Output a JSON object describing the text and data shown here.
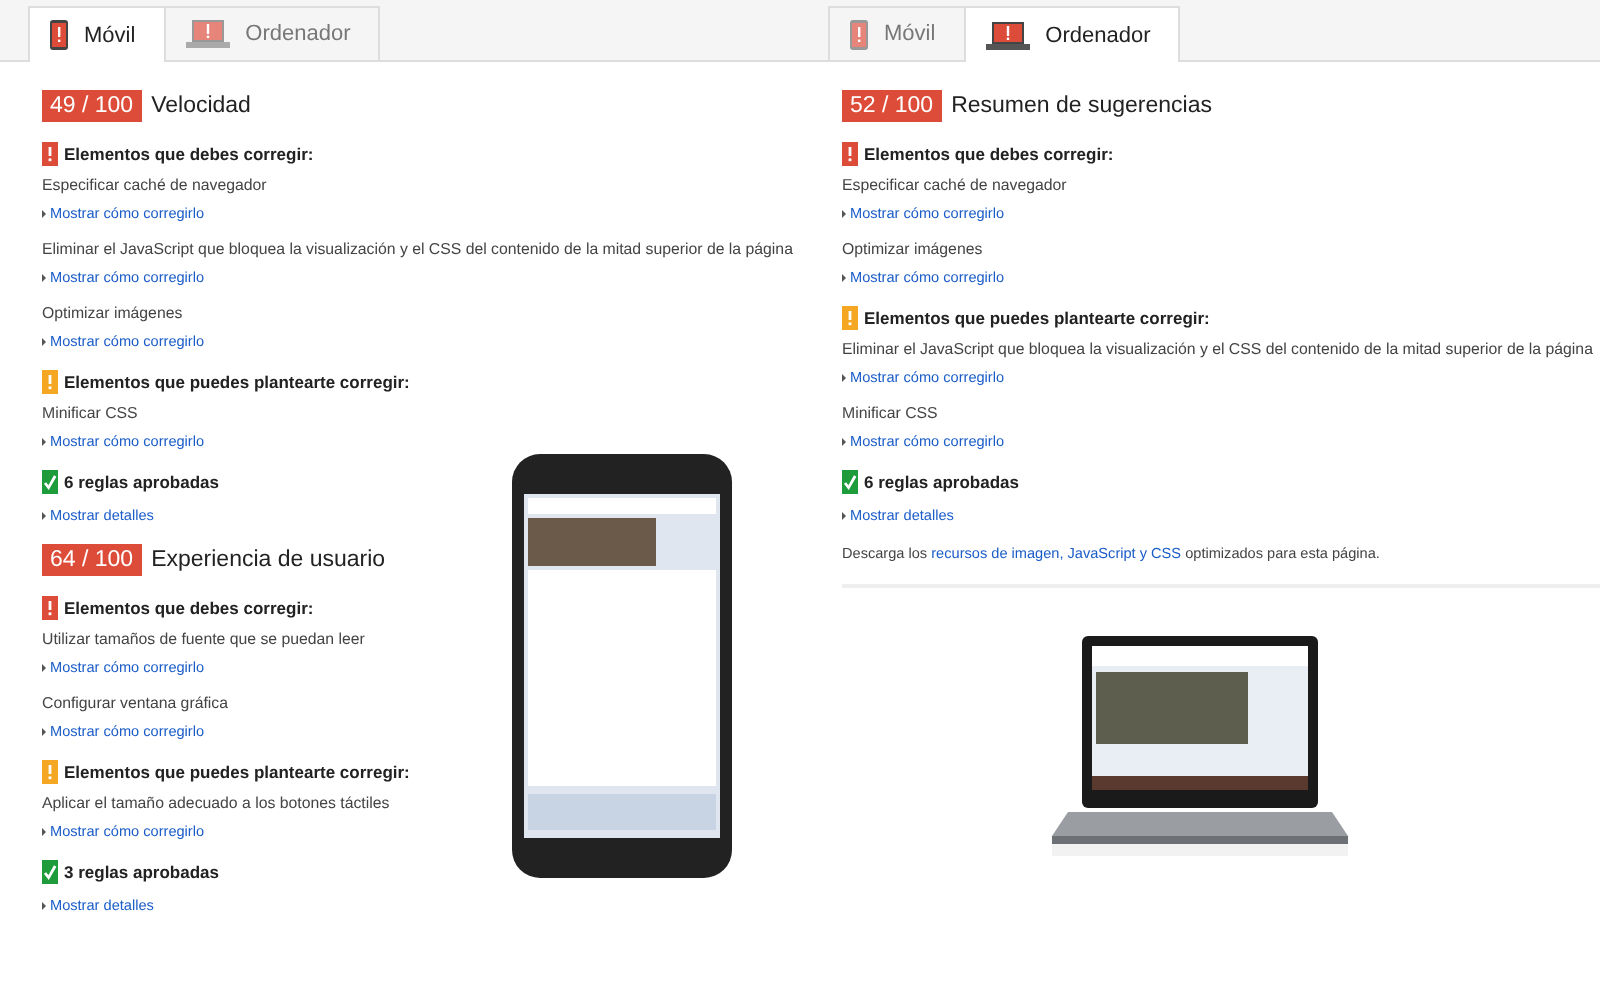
{
  "panels": [
    {
      "tabs": [
        {
          "label": "Móvil",
          "kind": "phone",
          "selected": true
        },
        {
          "label": "Ordenador",
          "kind": "laptop",
          "selected": false
        }
      ],
      "kind": "phone",
      "sections": [
        {
          "score": "49 / 100",
          "title": "Velocidad",
          "groups": [
            {
              "kind": "error",
              "heading": "Elementos que debes corregir:",
              "items": [
                {
                  "text": "Especificar caché de navegador",
                  "link": "Mostrar cómo corregirlo"
                },
                {
                  "text": "Eliminar el JavaScript que bloquea la visualización y el CSS del contenido de la mitad superior de la página",
                  "link": "Mostrar cómo corregirlo"
                },
                {
                  "text": "Optimizar imágenes",
                  "link": "Mostrar cómo corregirlo"
                }
              ]
            },
            {
              "kind": "warning",
              "heading": "Elementos que puedes plantearte corregir:",
              "items": [
                {
                  "text": "Minificar CSS",
                  "link": "Mostrar cómo corregirlo"
                }
              ]
            },
            {
              "kind": "pass",
              "heading": "6 reglas aprobadas",
              "items": [
                {
                  "link": "Mostrar detalles"
                }
              ]
            }
          ]
        },
        {
          "score": "64 / 100",
          "title": "Experiencia de usuario",
          "groups": [
            {
              "kind": "error",
              "heading": "Elementos que debes corregir:",
              "items": [
                {
                  "text": "Utilizar tamaños de fuente que se puedan leer",
                  "link": "Mostrar cómo corregirlo"
                },
                {
                  "text": "Configurar ventana gráfica",
                  "link": "Mostrar cómo corregirlo"
                }
              ]
            },
            {
              "kind": "warning",
              "heading": "Elementos que puedes plantearte corregir:",
              "items": [
                {
                  "text": "Aplicar el tamaño adecuado a los botones táctiles",
                  "link": "Mostrar cómo corregirlo"
                }
              ]
            },
            {
              "kind": "pass",
              "heading": "3 reglas aprobadas",
              "items": [
                {
                  "link": "Mostrar detalles"
                }
              ]
            }
          ]
        }
      ]
    },
    {
      "tabs": [
        {
          "label": "Móvil",
          "kind": "phone",
          "selected": false
        },
        {
          "label": "Ordenador",
          "kind": "laptop",
          "selected": true
        }
      ],
      "kind": "laptop",
      "sections": [
        {
          "score": "52 / 100",
          "title": "Resumen de sugerencias",
          "groups": [
            {
              "kind": "error",
              "heading": "Elementos que debes corregir:",
              "items": [
                {
                  "text": "Especificar caché de navegador",
                  "link": "Mostrar cómo corregirlo"
                },
                {
                  "text": "Optimizar imágenes",
                  "link": "Mostrar cómo corregirlo"
                }
              ]
            },
            {
              "kind": "warning",
              "heading": "Elementos que puedes plantearte corregir:",
              "items": [
                {
                  "text": "Eliminar el JavaScript que bloquea la visualización y el CSS del contenido de la mitad superior de la página",
                  "link": "Mostrar cómo corregirlo"
                },
                {
                  "text": "Minificar CSS",
                  "link": "Mostrar cómo corregirlo"
                }
              ]
            },
            {
              "kind": "pass",
              "heading": "6 reglas aprobadas",
              "items": [
                {
                  "link": "Mostrar detalles"
                }
              ]
            }
          ]
        }
      ],
      "download": {
        "before": "Descarga los",
        "link": "recursos de imagen, JavaScript y CSS",
        "after": "optimizados para esta página."
      }
    }
  ]
}
